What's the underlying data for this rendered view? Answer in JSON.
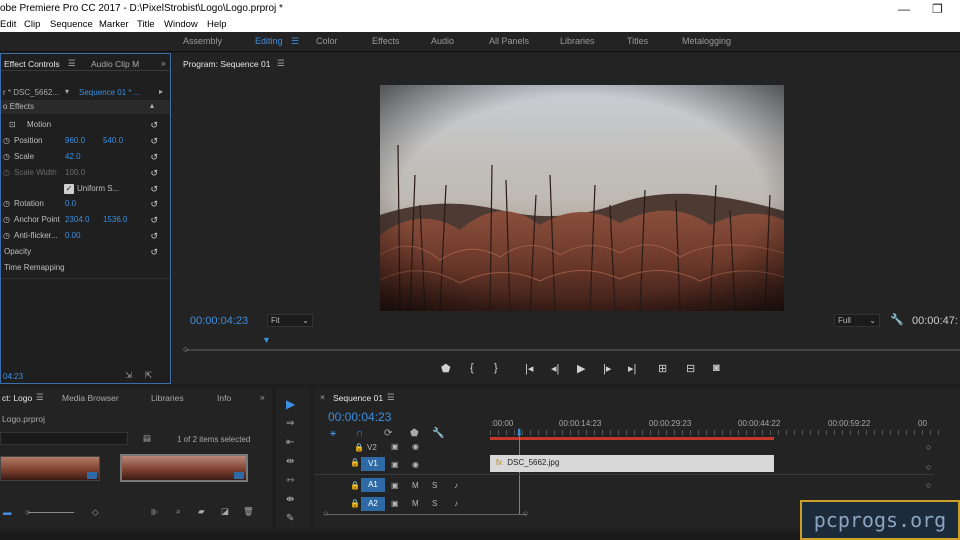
{
  "window": {
    "title": "obe Premiere Pro CC 2017 - D:\\PixelStrobist\\Logo\\Logo.prproj *",
    "min": "—",
    "max": "❐"
  },
  "menu": [
    "Edit",
    "Clip",
    "Sequence",
    "Marker",
    "Title",
    "Window",
    "Help"
  ],
  "workspaces": [
    "Assembly",
    "Editing",
    "Color",
    "Effects",
    "Audio",
    "All Panels",
    "Libraries",
    "Titles",
    "Metalogging"
  ],
  "effect_controls": {
    "tab1": "Effect Controls",
    "tab2": "Audio Clip M",
    "source": "r * DSC_5662...",
    "sequence": "Sequence 01 * ...",
    "section": "o Effects",
    "motion": "Motion",
    "position_label": "Position",
    "position_x": "960.0",
    "position_y": "540.0",
    "scale_label": "Scale",
    "scale_v": "42.0",
    "scale_width_label": "Scale Width",
    "scale_width_v": "100.0",
    "uniform": "Uniform S...",
    "rotation_label": "Rotation",
    "rotation_v": "0.0",
    "anchor_label": "Anchor Point",
    "anchor_x": "2304.0",
    "anchor_y": "1536.0",
    "flicker_label": "Anti-flicker...",
    "flicker_v": "0.00",
    "opacity": "Opacity",
    "time_remap": "Time Remapping",
    "footer_tc": "04:23"
  },
  "program": {
    "title": "Program: Sequence 01",
    "timecode": "00:00:04:23",
    "fit": "Fit",
    "full": "Full",
    "duration": "00:00:47:"
  },
  "project": {
    "tab": "ct: Logo",
    "tabs": [
      "Media Browser",
      "Libraries",
      "Info"
    ],
    "file": "Logo.prproj",
    "selected": "1 of 2 items selected"
  },
  "timeline": {
    "title": "Sequence 01",
    "timecode": "00:00:04:23",
    "ruler": [
      ":00:00",
      "00:00:14:23",
      "00:00:29:23",
      "00:00:44:22",
      "00:00:59:22",
      "00"
    ],
    "tracks": [
      "V2",
      "V1",
      "A1",
      "A2"
    ],
    "track_labels": {
      "v1src": "V1",
      "a1src": "A1",
      "a2src": "A2"
    },
    "mute": "M",
    "solo": "S",
    "clip": "DSC_5662.jpg"
  },
  "watermark": "pcprogs.org",
  "colors": {
    "accent": "#3c8ee0",
    "clip": "#d8d8d8",
    "workarea": "#c0392b"
  }
}
